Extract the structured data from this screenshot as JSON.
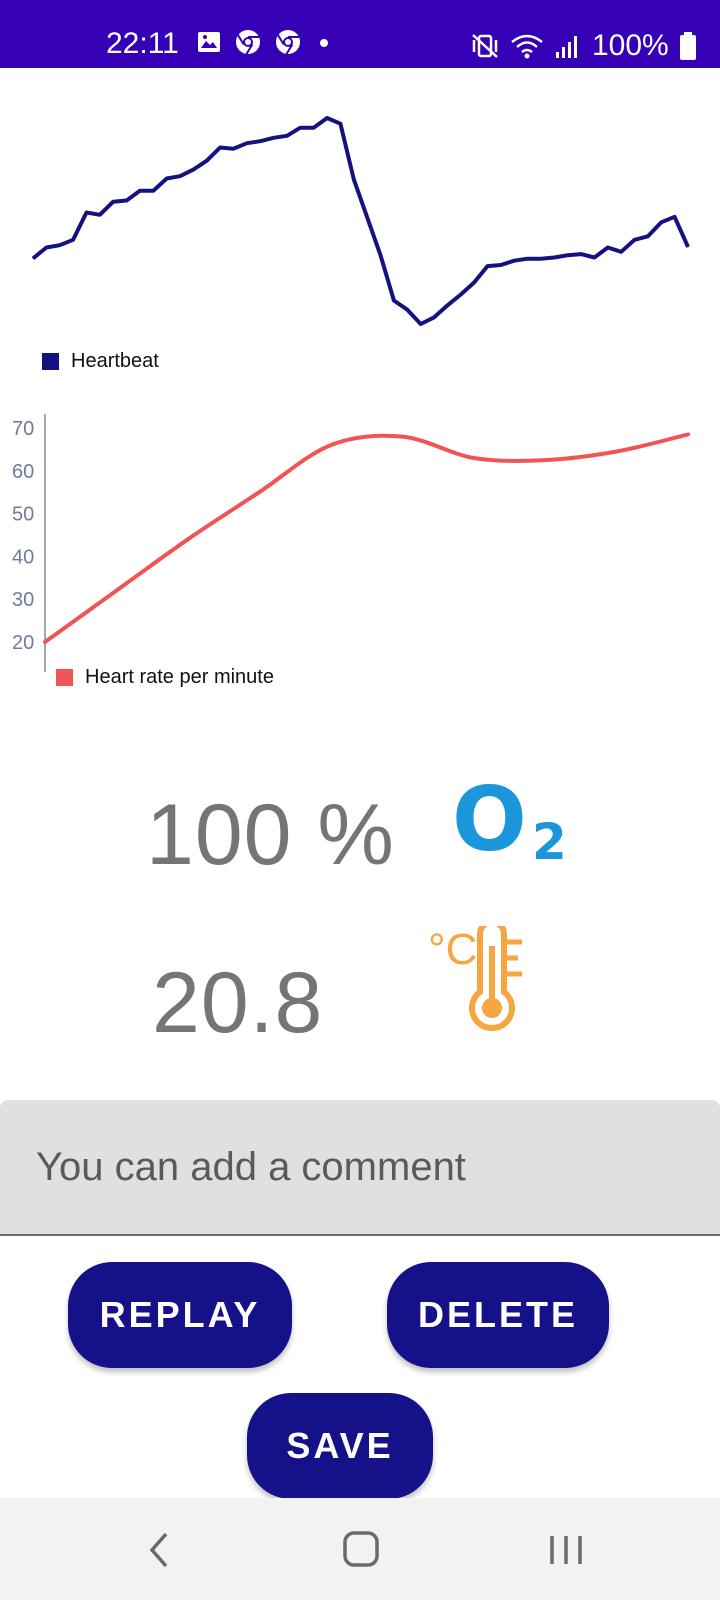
{
  "status_bar": {
    "time": "22:11",
    "battery_text": "100%",
    "left_icons": [
      "image-icon",
      "chrome-icon",
      "chrome-icon",
      "dot-icon"
    ],
    "right_icons": [
      "vibrate-mute-icon",
      "wifi-icon",
      "signal-icon",
      "battery-icon"
    ],
    "background": "#3500b6"
  },
  "chart_data": [
    {
      "type": "line",
      "title": "",
      "xlabel": "",
      "ylabel": "",
      "axes_visible": false,
      "grid": false,
      "legend_position": "bottom-left",
      "series": [
        {
          "name": "Heartbeat",
          "color": "#15127f",
          "x": [
            0,
            1,
            2,
            3,
            4,
            5,
            6,
            7,
            8,
            9,
            10,
            11,
            12,
            13,
            14,
            15,
            16,
            17,
            18,
            19,
            20,
            21,
            22,
            23,
            24,
            25,
            26,
            27,
            28,
            29,
            30,
            31,
            32,
            33,
            34,
            35,
            36,
            37,
            38,
            39,
            40,
            41,
            42,
            43,
            44,
            45,
            46,
            47,
            48,
            49
          ],
          "values": [
            51.0,
            54.8,
            55.6,
            57.5,
            67.0,
            66.2,
            70.8,
            71.2,
            74.6,
            74.6,
            78.9,
            79.7,
            82.0,
            85.1,
            89.7,
            89.3,
            91.2,
            91.9,
            93.1,
            93.8,
            96.6,
            96.6,
            100.0,
            98.0,
            78.6,
            65.3,
            52.0,
            36.3,
            33.1,
            28.1,
            30.4,
            34.6,
            38.4,
            42.6,
            48.3,
            48.7,
            50.2,
            50.9,
            50.9,
            51.3,
            52.1,
            52.5,
            51.3,
            54.8,
            53.3,
            57.5,
            58.7,
            63.6,
            65.5,
            55.0
          ]
        }
      ]
    },
    {
      "type": "line",
      "title": "",
      "xlabel": "",
      "ylabel": "",
      "ylim": [
        20,
        70
      ],
      "y_ticks": [
        "70",
        "60",
        "50",
        "40",
        "30",
        "20"
      ],
      "x_axis_visible": false,
      "grid": false,
      "legend_position": "bottom-left",
      "series": [
        {
          "name": "Heart rate per minute",
          "color": "#f05454",
          "x": [
            0,
            1,
            2,
            3,
            4,
            5,
            6,
            7,
            8,
            9
          ],
          "values": [
            20.0,
            32.0,
            44.0,
            55.0,
            66.0,
            68.0,
            63.0,
            62.5,
            64.5,
            68.5
          ]
        }
      ]
    }
  ],
  "metrics": {
    "oxygen_value": "100 %",
    "oxygen_icon": "o2-icon",
    "oxygen_label": "O",
    "oxygen_sub": "2",
    "oxygen_color": "#1b96db",
    "temperature_value": "20.8",
    "temperature_icon": "thermometer-celsius-icon",
    "temperature_unit": "°C",
    "temperature_color": "#f5a641"
  },
  "comment": {
    "placeholder": "You can add a comment",
    "value": ""
  },
  "buttons": {
    "replay_label": "REPLAY",
    "delete_label": "DELETE",
    "save_label": "SAVE",
    "color": "#151189"
  },
  "nav_bar": {
    "icons": [
      "back-icon",
      "home-icon",
      "recents-icon"
    ]
  }
}
